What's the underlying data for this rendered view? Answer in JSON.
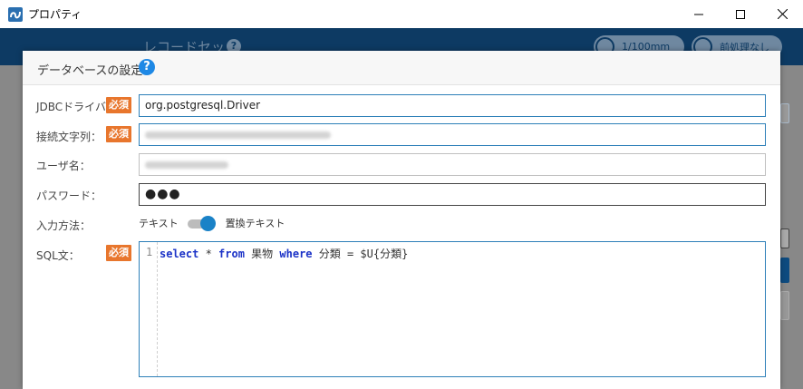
{
  "window": {
    "title": "プロパティ"
  },
  "background_app": {
    "section_title": "レコードセット",
    "unit_label": "1/100mm",
    "preprocess_label": "前処理なし"
  },
  "dialog": {
    "title": "データベースの設定",
    "required_badge": "必須",
    "driver": {
      "label": "JDBCドライバ：",
      "value": "org.postgresql.Driver"
    },
    "connection": {
      "label": "接続文字列："
    },
    "username": {
      "label": "ユーザ名："
    },
    "password": {
      "label": "パスワード：",
      "value": "●●●"
    },
    "input_method": {
      "label": "入力方法：",
      "option_text": "テキスト",
      "option_replace": "置換テキスト",
      "selected": "置換テキスト"
    },
    "sql": {
      "label": "SQL文：",
      "line_number": "1",
      "tokens": {
        "select": "select",
        "star": " * ",
        "from": "from",
        "table": " 果物 ",
        "where": "where",
        "rest": " 分類 = $U{分類}"
      }
    }
  },
  "colors": {
    "accent": "#1a82c7",
    "required": "#e8762d",
    "header_bg": "#0d3a63",
    "keyword": "#1c33c7"
  }
}
